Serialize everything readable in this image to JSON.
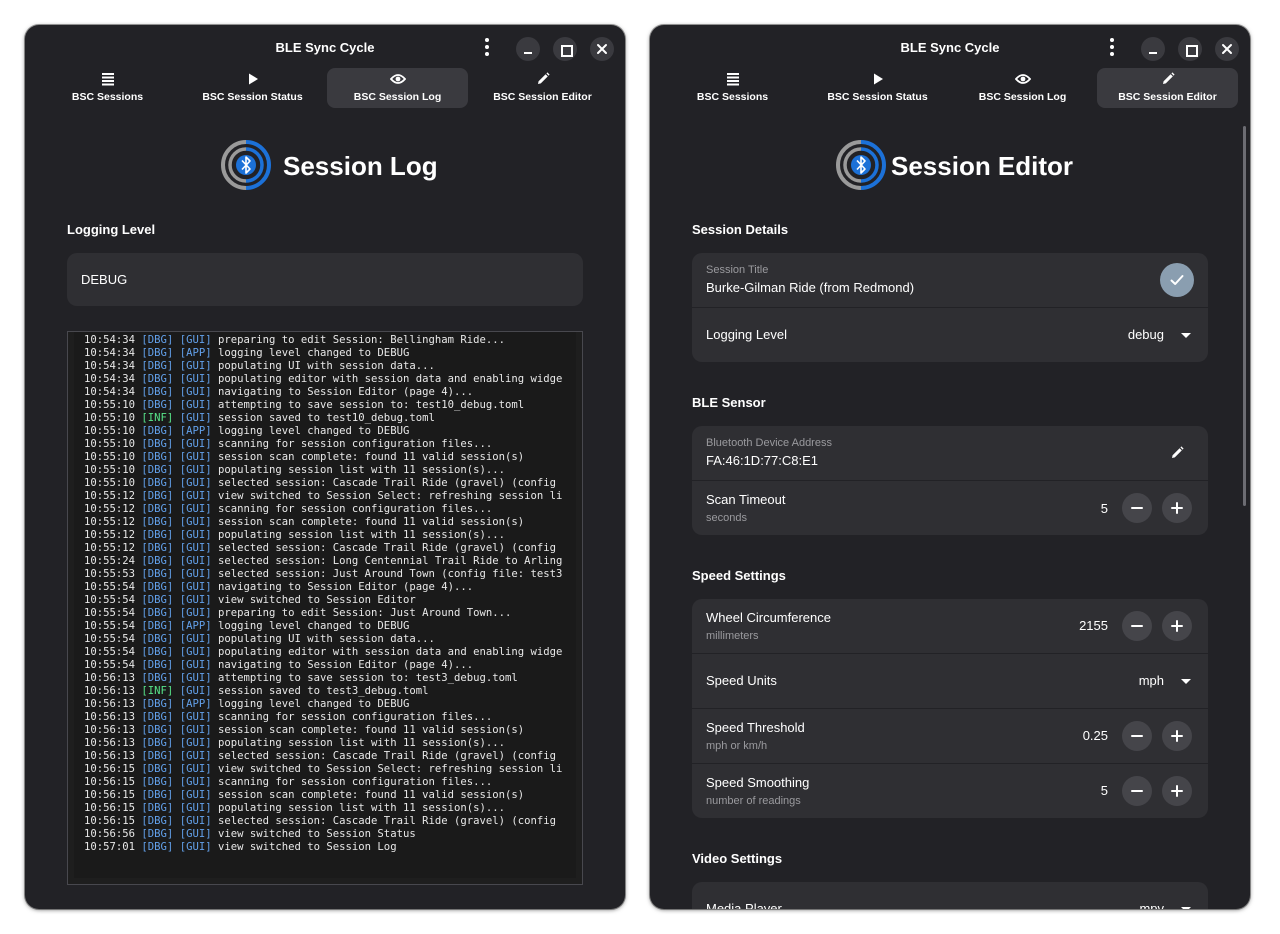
{
  "left_window": {
    "title": "BLE Sync Cycle",
    "tabs": [
      {
        "label": "BSC Sessions",
        "icon": "list-icon"
      },
      {
        "label": "BSC Session Status",
        "icon": "play-icon"
      },
      {
        "label": "BSC Session Log",
        "icon": "eye-icon",
        "active": true
      },
      {
        "label": "BSC Session Editor",
        "icon": "pencil-icon"
      }
    ],
    "page_title": "Session Log",
    "logging_level_label": "Logging Level",
    "logging_level_value": "DEBUG",
    "log_lines": [
      {
        "time": "10:54:34",
        "level": "[DBG]",
        "cat": "[GUI]",
        "msg": "preparing to edit Session: Bellingham Ride..."
      },
      {
        "time": "10:54:34",
        "level": "[DBG]",
        "cat": "[APP]",
        "msg": "logging level changed to DEBUG"
      },
      {
        "time": "10:54:34",
        "level": "[DBG]",
        "cat": "[GUI]",
        "msg": "populating UI with session data..."
      },
      {
        "time": "10:54:34",
        "level": "[DBG]",
        "cat": "[GUI]",
        "msg": "populating editor with session data and enabling widge"
      },
      {
        "time": "10:54:34",
        "level": "[DBG]",
        "cat": "[GUI]",
        "msg": "navigating to Session Editor (page 4)..."
      },
      {
        "time": "10:55:10",
        "level": "[DBG]",
        "cat": "[GUI]",
        "msg": "attempting to save session to: test10_debug.toml"
      },
      {
        "time": "10:55:10",
        "level": "[INF]",
        "cat": "[GUI]",
        "msg": "session saved to test10_debug.toml"
      },
      {
        "time": "10:55:10",
        "level": "[DBG]",
        "cat": "[APP]",
        "msg": "logging level changed to DEBUG"
      },
      {
        "time": "10:55:10",
        "level": "[DBG]",
        "cat": "[GUI]",
        "msg": "scanning for session configuration files..."
      },
      {
        "time": "10:55:10",
        "level": "[DBG]",
        "cat": "[GUI]",
        "msg": "session scan complete: found 11 valid session(s)"
      },
      {
        "time": "10:55:10",
        "level": "[DBG]",
        "cat": "[GUI]",
        "msg": "populating session list with 11 session(s)..."
      },
      {
        "time": "10:55:10",
        "level": "[DBG]",
        "cat": "[GUI]",
        "msg": "selected session: Cascade Trail Ride (gravel) (config"
      },
      {
        "time": "10:55:12",
        "level": "[DBG]",
        "cat": "[GUI]",
        "msg": "view switched to Session Select: refreshing session li"
      },
      {
        "time": "10:55:12",
        "level": "[DBG]",
        "cat": "[GUI]",
        "msg": "scanning for session configuration files..."
      },
      {
        "time": "10:55:12",
        "level": "[DBG]",
        "cat": "[GUI]",
        "msg": "session scan complete: found 11 valid session(s)"
      },
      {
        "time": "10:55:12",
        "level": "[DBG]",
        "cat": "[GUI]",
        "msg": "populating session list with 11 session(s)..."
      },
      {
        "time": "10:55:12",
        "level": "[DBG]",
        "cat": "[GUI]",
        "msg": "selected session: Cascade Trail Ride (gravel) (config"
      },
      {
        "time": "10:55:24",
        "level": "[DBG]",
        "cat": "[GUI]",
        "msg": "selected session: Long Centennial Trail Ride to Arling"
      },
      {
        "time": "10:55:53",
        "level": "[DBG]",
        "cat": "[GUI]",
        "msg": "selected session: Just Around Town (config file: test3"
      },
      {
        "time": "10:55:54",
        "level": "[DBG]",
        "cat": "[GUI]",
        "msg": "navigating to Session Editor (page 4)..."
      },
      {
        "time": "10:55:54",
        "level": "[DBG]",
        "cat": "[GUI]",
        "msg": "view switched to Session Editor"
      },
      {
        "time": "10:55:54",
        "level": "[DBG]",
        "cat": "[GUI]",
        "msg": "preparing to edit Session: Just Around Town..."
      },
      {
        "time": "10:55:54",
        "level": "[DBG]",
        "cat": "[APP]",
        "msg": "logging level changed to DEBUG"
      },
      {
        "time": "10:55:54",
        "level": "[DBG]",
        "cat": "[GUI]",
        "msg": "populating UI with session data..."
      },
      {
        "time": "10:55:54",
        "level": "[DBG]",
        "cat": "[GUI]",
        "msg": "populating editor with session data and enabling widge"
      },
      {
        "time": "10:55:54",
        "level": "[DBG]",
        "cat": "[GUI]",
        "msg": "navigating to Session Editor (page 4)..."
      },
      {
        "time": "10:56:13",
        "level": "[DBG]",
        "cat": "[GUI]",
        "msg": "attempting to save session to: test3_debug.toml"
      },
      {
        "time": "10:56:13",
        "level": "[INF]",
        "cat": "[GUI]",
        "msg": "session saved to test3_debug.toml"
      },
      {
        "time": "10:56:13",
        "level": "[DBG]",
        "cat": "[APP]",
        "msg": "logging level changed to DEBUG"
      },
      {
        "time": "10:56:13",
        "level": "[DBG]",
        "cat": "[GUI]",
        "msg": "scanning for session configuration files..."
      },
      {
        "time": "10:56:13",
        "level": "[DBG]",
        "cat": "[GUI]",
        "msg": "session scan complete: found 11 valid session(s)"
      },
      {
        "time": "10:56:13",
        "level": "[DBG]",
        "cat": "[GUI]",
        "msg": "populating session list with 11 session(s)..."
      },
      {
        "time": "10:56:13",
        "level": "[DBG]",
        "cat": "[GUI]",
        "msg": "selected session: Cascade Trail Ride (gravel) (config"
      },
      {
        "time": "10:56:15",
        "level": "[DBG]",
        "cat": "[GUI]",
        "msg": "view switched to Session Select: refreshing session li"
      },
      {
        "time": "10:56:15",
        "level": "[DBG]",
        "cat": "[GUI]",
        "msg": "scanning for session configuration files..."
      },
      {
        "time": "10:56:15",
        "level": "[DBG]",
        "cat": "[GUI]",
        "msg": "session scan complete: found 11 valid session(s)"
      },
      {
        "time": "10:56:15",
        "level": "[DBG]",
        "cat": "[GUI]",
        "msg": "populating session list with 11 session(s)..."
      },
      {
        "time": "10:56:15",
        "level": "[DBG]",
        "cat": "[GUI]",
        "msg": "selected session: Cascade Trail Ride (gravel) (config"
      },
      {
        "time": "10:56:56",
        "level": "[DBG]",
        "cat": "[GUI]",
        "msg": "view switched to Session Status"
      },
      {
        "time": "10:57:01",
        "level": "[DBG]",
        "cat": "[GUI]",
        "msg": "view switched to Session Log"
      }
    ]
  },
  "right_window": {
    "title": "BLE Sync Cycle",
    "tabs": [
      {
        "label": "BSC Sessions",
        "icon": "list-icon"
      },
      {
        "label": "BSC Session Status",
        "icon": "play-icon"
      },
      {
        "label": "BSC Session Log",
        "icon": "eye-icon"
      },
      {
        "label": "BSC Session Editor",
        "icon": "pencil-icon",
        "active": true
      }
    ],
    "page_title": "Session Editor",
    "session_details": {
      "label": "Session Details",
      "title_caption": "Session Title",
      "title_value": "Burke-Gilman Ride (from Redmond)",
      "logging_level_label": "Logging Level",
      "logging_level_value": "debug"
    },
    "ble_sensor": {
      "label": "BLE Sensor",
      "address_caption": "Bluetooth Device Address",
      "address_value": "FA:46:1D:77:C8:E1",
      "scan_timeout_label": "Scan Timeout",
      "scan_timeout_sub": "seconds",
      "scan_timeout_value": "5"
    },
    "speed_settings": {
      "label": "Speed Settings",
      "wheel_label": "Wheel Circumference",
      "wheel_sub": "millimeters",
      "wheel_value": "2155",
      "units_label": "Speed Units",
      "units_value": "mph",
      "threshold_label": "Speed Threshold",
      "threshold_sub": "mph or km/h",
      "threshold_value": "0.25",
      "smoothing_label": "Speed Smoothing",
      "smoothing_sub": "number of readings",
      "smoothing_value": "5"
    },
    "video_settings": {
      "label": "Video Settings",
      "media_player_label": "Media Player",
      "media_player_value": "mpv"
    }
  },
  "colors": {
    "window_bg": "#222226",
    "card_bg": "#2f2f33",
    "accent_blue": "#62a0ea",
    "info_green": "#57e389",
    "check_button": "#8a9eb0"
  }
}
